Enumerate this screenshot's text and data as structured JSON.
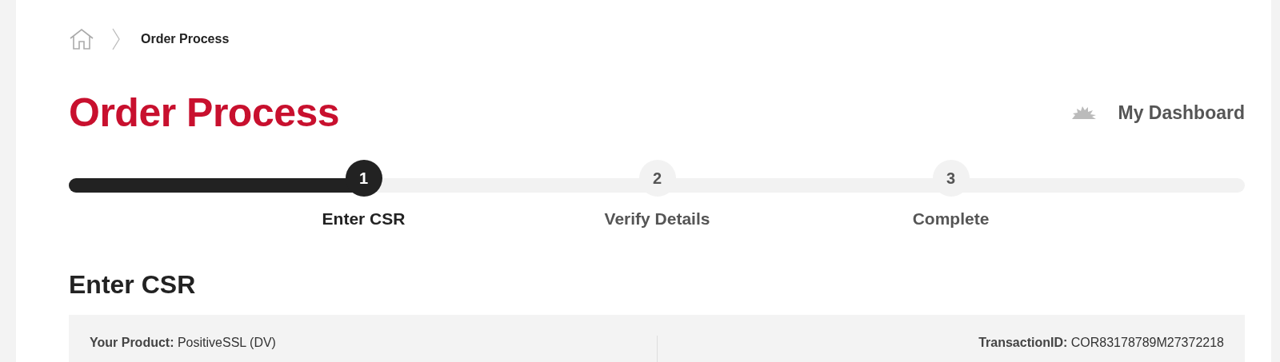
{
  "breadcrumb": {
    "current": "Order Process"
  },
  "page_title": "Order Process",
  "dashboard_link": "My Dashboard",
  "progress": {
    "level": 0.25,
    "steps": [
      {
        "number": "1",
        "label": "Enter CSR",
        "selected": true
      },
      {
        "number": "2",
        "label": "Verify Details",
        "selected": false
      },
      {
        "number": "3",
        "label": "Complete",
        "selected": false
      }
    ]
  },
  "section_title": "Enter CSR",
  "info": [
    {
      "label": "Your Product:",
      "value": "PositiveSSL (DV)"
    },
    {
      "label": "TransactionID:",
      "value": "COR83178789M27372218"
    }
  ]
}
